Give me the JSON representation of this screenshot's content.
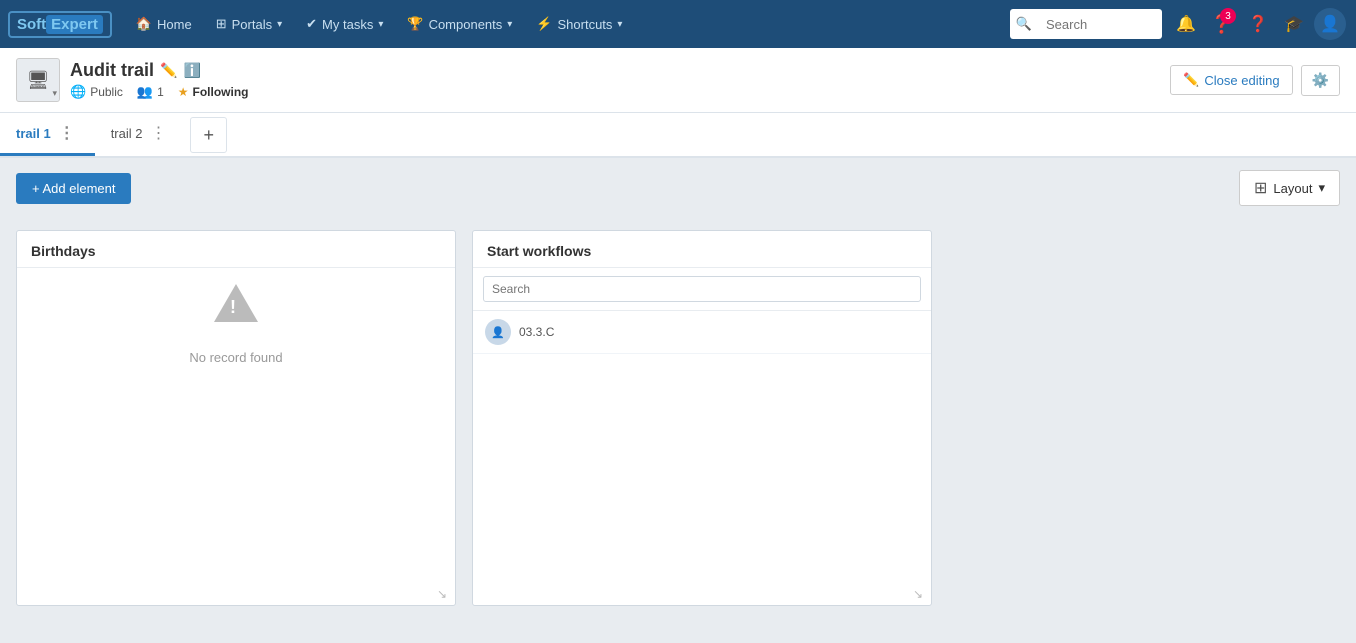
{
  "brand": {
    "soft": "Soft",
    "expert": "Expert"
  },
  "topnav": {
    "home_label": "Home",
    "portals_label": "Portals",
    "mytasks_label": "My tasks",
    "components_label": "Components",
    "shortcuts_label": "Shortcuts",
    "search_placeholder": "Search",
    "notification_count": "3"
  },
  "subheader": {
    "title": "Audit trail",
    "public_label": "Public",
    "members_count": "1",
    "following_label": "Following",
    "close_editing_label": "Close editing"
  },
  "tabs": {
    "tab1_label": "trail 1",
    "tab2_label": "trail 2",
    "add_tooltip": "+"
  },
  "toolbar": {
    "add_element_label": "+ Add element",
    "layout_label": "Layout"
  },
  "widgets": {
    "birthdays": {
      "title": "Birthdays",
      "no_record": "No record found"
    },
    "start_workflows": {
      "title": "Start workflows",
      "search_placeholder": "Search",
      "item_label": "03.3.C"
    }
  }
}
